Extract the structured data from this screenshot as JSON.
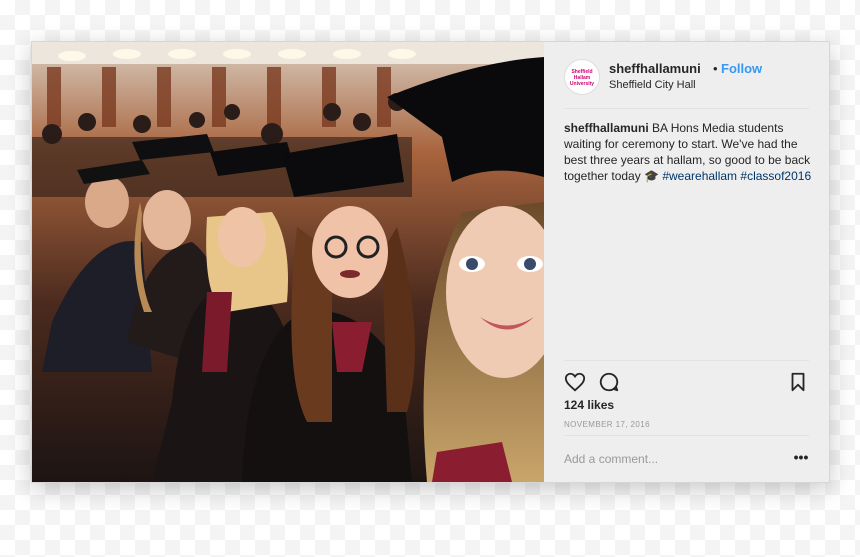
{
  "post": {
    "photo_alt": "Graduation selfie in Sheffield City Hall",
    "avatar_text": [
      "Sheffield",
      "Hallam",
      "University"
    ],
    "username": "sheffhallamuni",
    "separator": "•",
    "follow_label": "Follow",
    "location": "Sheffield City Hall",
    "caption": {
      "user": "sheffhallamuni",
      "text": "BA Hons Media students waiting for ceremony to start. We've had the best three years at hallam, so good to be back together today 🎓",
      "hashtags": [
        "#wearehallam",
        "#classof2016"
      ]
    },
    "likes": "124 likes",
    "date": "NOVEMBER 17, 2016",
    "comment_placeholder": "Add a comment...",
    "more_label": "•••"
  },
  "icons": {
    "like": "heart-icon",
    "comment": "speech-bubble-icon",
    "save": "bookmark-icon",
    "more": "ellipsis-icon"
  },
  "colors": {
    "link_blue": "#3897f0",
    "hashtag": "#003569",
    "panel_bg": "#eeeeee",
    "brand_magenta": "#d0006f"
  }
}
